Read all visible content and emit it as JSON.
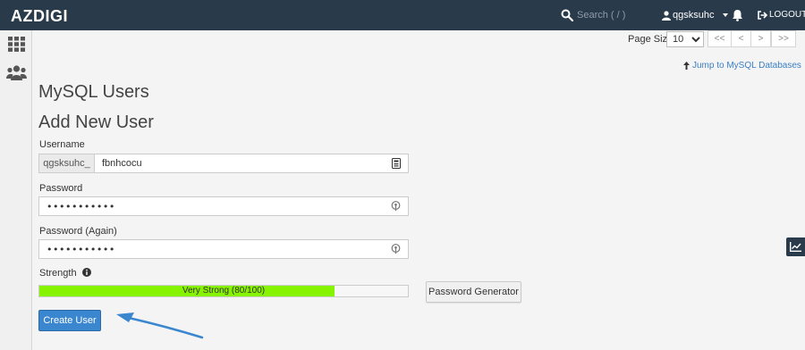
{
  "header": {
    "brand": "AZDIGI",
    "search_placeholder": "Search ( / )",
    "username": "qgsksuhc",
    "logout_label": "LOGOUT"
  },
  "pager": {
    "page_size_label": "Page Size",
    "page_size_value": "10",
    "first_label": "<<",
    "prev_label": "<",
    "next_label": ">",
    "last_label": ">>"
  },
  "jump_link": "Jump to MySQL Databases",
  "headings": {
    "title": "MySQL Users",
    "subtitle": "Add New User"
  },
  "form": {
    "username_label": "Username",
    "username_prefix": "qgsksuhc_",
    "username_value": "fbnhcocu",
    "password_label": "Password",
    "password_value": "•••••••••••",
    "password_again_label": "Password (Again)",
    "password_again_value": "•••••••••••",
    "strength_label": "Strength",
    "strength_text": "Very Strong (80/100)",
    "strength_percent": 80,
    "generator_label": "Password Generator",
    "create_label": "Create User"
  },
  "colors": {
    "topbar": "#293a4a",
    "strength_fill": "#86f300",
    "primary_button": "#3a86cf",
    "annotation_arrow": "#3a86cf"
  }
}
